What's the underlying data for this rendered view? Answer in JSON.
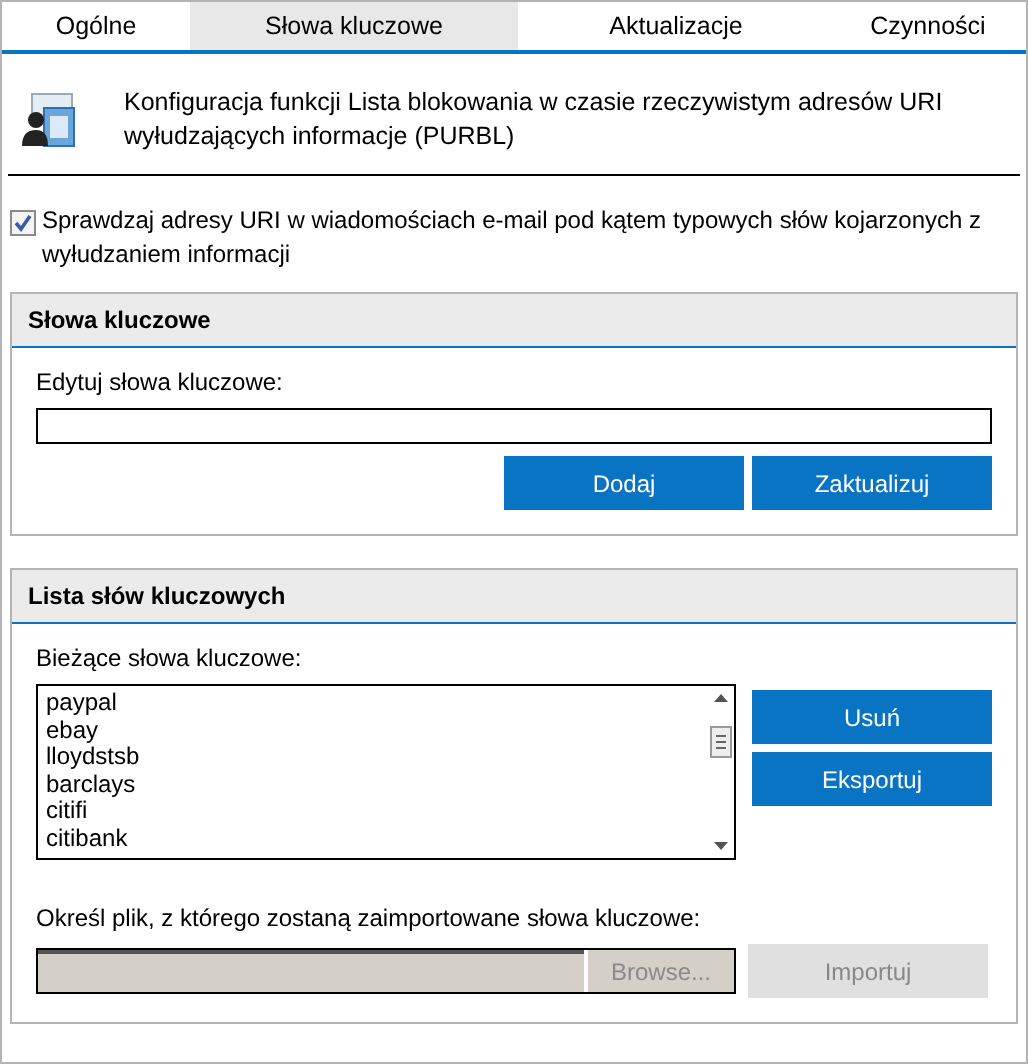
{
  "tabs": [
    {
      "label": "Ogólne",
      "selected": false
    },
    {
      "label": "Słowa kluczowe",
      "selected": true
    },
    {
      "label": "Aktualizacje",
      "selected": false
    },
    {
      "label": "Czynności",
      "selected": false
    }
  ],
  "header": {
    "text": "Konfiguracja funkcji Lista blokowania w czasie rzeczywistym adresów URI wyłudzających informacje (PURBL)"
  },
  "check_option": {
    "label": "Sprawdzaj adresy URI w wiadomościach e-mail pod kątem typowych słów kojarzonych z wyłudzaniem informacji",
    "checked": true
  },
  "keywords_section": {
    "title": "Słowa kluczowe",
    "field_label": "Edytuj słowa kluczowe:",
    "buttons": [
      {
        "label": "Dodaj",
        "disabled": false
      },
      {
        "label": "Zaktualizuj",
        "disabled": false
      }
    ]
  },
  "list_section": {
    "title": "Lista słów kluczowych",
    "list_label": "Bieżące słowa kluczowe:",
    "items": [
      "paypal",
      "ebay",
      "lloydstsb",
      "barclays",
      "citifi",
      "citibank"
    ],
    "side_buttons": [
      {
        "label": "Usuń",
        "disabled": false
      },
      {
        "label": "Eksportuj",
        "disabled": false
      }
    ],
    "import_label": "Określ plik, z którego zostaną zaimportowane słowa kluczowe:",
    "browse_button": {
      "label": "Browse...",
      "disabled": true
    },
    "import_button": {
      "label": "Importuj",
      "disabled": true
    }
  }
}
